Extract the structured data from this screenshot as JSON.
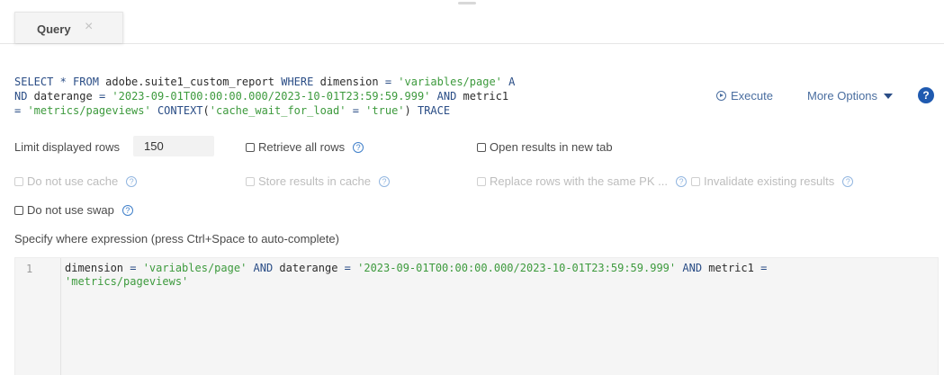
{
  "tabs": [
    {
      "label": "Query",
      "close": "×"
    }
  ],
  "query": {
    "sql_lines": [
      [
        {
          "t": "SELECT ",
          "c": "kw"
        },
        {
          "t": "* ",
          "c": "kw"
        },
        {
          "t": "FROM ",
          "c": "kw"
        },
        {
          "t": "adobe.suite1_custom_report ",
          "c": "tx"
        },
        {
          "t": "WHERE ",
          "c": "kw"
        },
        {
          "t": "dimension ",
          "c": "tx"
        },
        {
          "t": "= ",
          "c": "kw"
        },
        {
          "t": "'variables/page'",
          "c": "str"
        },
        {
          "t": " A",
          "c": "kw"
        }
      ],
      [
        {
          "t": "ND",
          "c": "kw"
        },
        {
          "t": " daterange ",
          "c": "tx"
        },
        {
          "t": "= ",
          "c": "kw"
        },
        {
          "t": "'2023-09-01T00:00:00.000/2023-10-01T23:59:59.999'",
          "c": "str"
        },
        {
          "t": " AND ",
          "c": "kw"
        },
        {
          "t": "metric1",
          "c": "tx"
        }
      ],
      [
        {
          "t": "= ",
          "c": "kw"
        },
        {
          "t": "'metrics/pageviews'",
          "c": "str"
        },
        {
          "t": " CONTEXT",
          "c": "kw"
        },
        {
          "t": "(",
          "c": "tx"
        },
        {
          "t": "'cache_wait_for_load'",
          "c": "str"
        },
        {
          "t": " = ",
          "c": "kw"
        },
        {
          "t": "'true'",
          "c": "str"
        },
        {
          "t": ") ",
          "c": "tx"
        },
        {
          "t": "TRACE",
          "c": "kw"
        }
      ]
    ],
    "execute_label": "Execute",
    "more_options_label": "More Options",
    "help_label": "?"
  },
  "options": {
    "limit_label": "Limit displayed rows",
    "limit_value": "150",
    "retrieve_all": "Retrieve all rows",
    "open_new_tab": "Open results in new tab",
    "do_not_use_cache": "Do not use cache",
    "store_in_cache": "Store results in cache",
    "replace_rows": "Replace rows with the same PK ...",
    "invalidate": "Invalidate existing results",
    "do_not_use_swap": "Do not use swap",
    "help_glyph": "?"
  },
  "where": {
    "label": "Specify where expression (press Ctrl+Space to auto-complete)",
    "line_number": "1",
    "code_lines": [
      [
        {
          "t": "dimension ",
          "c": "tx"
        },
        {
          "t": "= ",
          "c": "kw"
        },
        {
          "t": "'variables/page'",
          "c": "str"
        },
        {
          "t": " AND ",
          "c": "kw"
        },
        {
          "t": "daterange ",
          "c": "tx"
        },
        {
          "t": "= ",
          "c": "kw"
        },
        {
          "t": "'2023-09-01T00:00:00.000/2023-10-01T23:59:59.999'",
          "c": "str"
        },
        {
          "t": " AND ",
          "c": "kw"
        },
        {
          "t": "metric1 ",
          "c": "tx"
        },
        {
          "t": "=",
          "c": "kw"
        }
      ],
      [
        {
          "t": "'metrics/pageviews'",
          "c": "str"
        }
      ]
    ]
  },
  "colors": {
    "keyword": "#2a4d86",
    "string": "#3d9a3d",
    "link": "#4a6ea0",
    "help_badge": "#1f5ab0"
  }
}
